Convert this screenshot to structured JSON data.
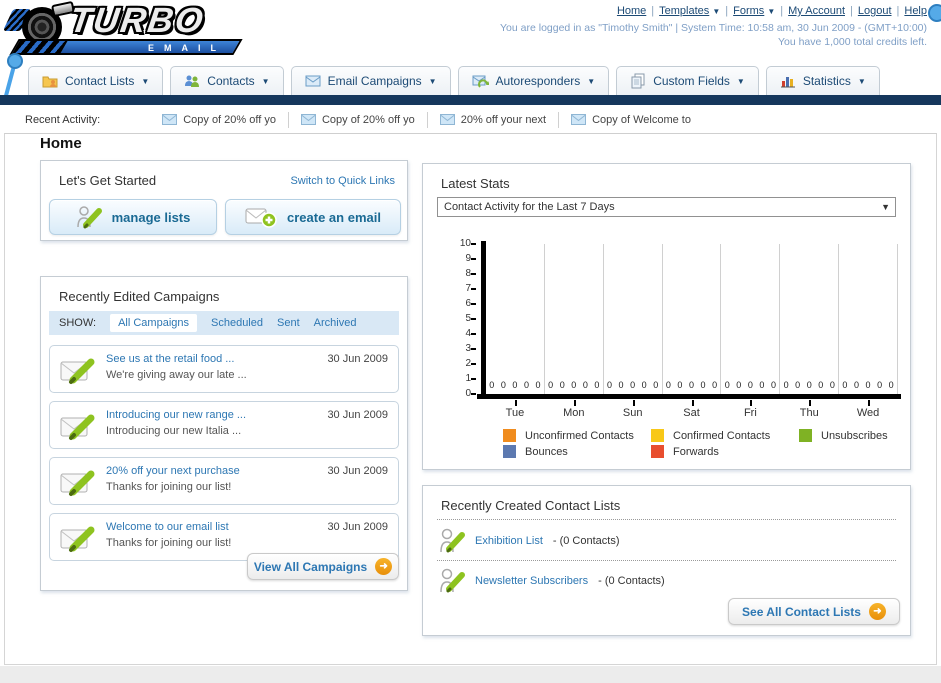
{
  "header": {
    "logo_title": "TURBO",
    "logo_subtitle": "EMAIL",
    "separator": "|",
    "links": [
      {
        "label": "Home"
      },
      {
        "label": "Templates",
        "dropdown": true
      },
      {
        "label": "Forms",
        "dropdown": true
      },
      {
        "label": "My Account"
      },
      {
        "label": "Logout"
      },
      {
        "label": "Help"
      }
    ],
    "login_line1": "You are logged in as \"Timothy Smith\" | System Time: 10:58 am, 30 Jun 2009 - (GMT+10:00)",
    "login_line2": "You have 1,000 total credits left."
  },
  "nav": {
    "tabs": [
      {
        "label": "Contact Lists"
      },
      {
        "label": "Contacts"
      },
      {
        "label": "Email Campaigns"
      },
      {
        "label": "Autoresponders"
      },
      {
        "label": "Custom Fields"
      },
      {
        "label": "Statistics"
      }
    ]
  },
  "recent_activity": {
    "label": "Recent Activity:",
    "items": [
      "Copy of 20% off yo",
      "Copy of 20% off yo",
      "20% off your next",
      "Copy of Welcome to"
    ]
  },
  "page": {
    "title": "Home"
  },
  "get_started": {
    "title": "Let's Get Started",
    "switch_link": "Switch to Quick Links",
    "manage_lists_label": "manage lists",
    "create_email_label": "create an email"
  },
  "campaigns": {
    "title": "Recently Edited Campaigns",
    "show_label": "SHOW:",
    "filters": [
      "All Campaigns",
      "Scheduled",
      "Sent",
      "Archived"
    ],
    "active_filter": "All Campaigns",
    "items": [
      {
        "title": "See us at the retail food ...",
        "subtitle": "We're giving away our late ...",
        "date": "30 Jun 2009"
      },
      {
        "title": "Introducing our new range ...",
        "subtitle": "Introducing our new Italia ...",
        "date": "30 Jun 2009"
      },
      {
        "title": "20% off your next purchase",
        "subtitle": "Thanks for joining our list!",
        "date": "30 Jun 2009"
      },
      {
        "title": "Welcome to our email list",
        "subtitle": "Thanks for joining our list!",
        "date": "30 Jun 2009"
      }
    ],
    "view_all_label": "View All Campaigns"
  },
  "stats": {
    "title": "Latest Stats",
    "selected_report": "Contact Activity for the Last 7 Days",
    "chart_data": {
      "type": "bar",
      "categories": [
        "Tue",
        "Mon",
        "Sun",
        "Sat",
        "Fri",
        "Thu",
        "Wed"
      ],
      "series": [
        {
          "name": "Unconfirmed Contacts",
          "color": "#f08c1e",
          "values": [
            0,
            0,
            0,
            0,
            0,
            0,
            0
          ]
        },
        {
          "name": "Confirmed Contacts",
          "color": "#f8c818",
          "values": [
            0,
            0,
            0,
            0,
            0,
            0,
            0
          ]
        },
        {
          "name": "Unsubscribes",
          "color": "#7fb224",
          "values": [
            0,
            0,
            0,
            0,
            0,
            0,
            0
          ]
        },
        {
          "name": "Bounces",
          "color": "#5c79b0",
          "values": [
            0,
            0,
            0,
            0,
            0,
            0,
            0
          ]
        },
        {
          "name": "Forwards",
          "color": "#e84e2e",
          "values": [
            0,
            0,
            0,
            0,
            0,
            0,
            0
          ]
        }
      ],
      "ylim": [
        0,
        10
      ],
      "ytick_step": 1,
      "show_value_labels": true,
      "grid": "vertical",
      "legend_position": "bottom"
    }
  },
  "contact_lists": {
    "title": "Recently Created Contact Lists",
    "items": [
      {
        "name": "Exhibition List",
        "detail": "- (0 Contacts)"
      },
      {
        "name": "Newsletter Subscribers",
        "detail": "- (0 Contacts)"
      }
    ],
    "see_all_label": "See All Contact Lists"
  },
  "colors": {
    "navy_strip": "#15375c",
    "link_blue": "#2d77b3",
    "brand_blue": "#2a6cc8",
    "button_arrow_orange": "#f0a11c"
  }
}
